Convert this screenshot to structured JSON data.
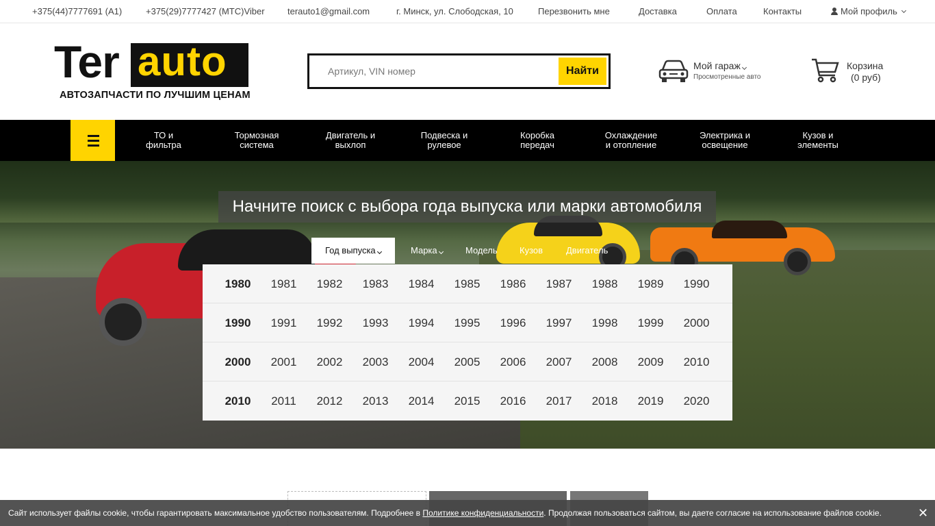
{
  "topbar": {
    "phone_a1": "+375(44)7777691 (A1)",
    "phone_mts": "+375(29)7777427 (МТС)Viber",
    "email": "terauto1@gmail.com",
    "address": "г. Минск, ул. Слободская, 10",
    "callback": "Перезвонить мне",
    "delivery": "Доставка",
    "payment": "Оплата",
    "contacts": "Контакты",
    "profile": "Мой профиль"
  },
  "logo": {
    "part1": "Ter",
    "part2": "auto",
    "tagline": "АВТОЗАПЧАСТИ ПО ЛУЧШИМ ЦЕНАМ"
  },
  "search": {
    "placeholder": "Артикул, VIN номер",
    "button": "Найти"
  },
  "garage": {
    "title": "Мой гараж",
    "subtitle": "Просмотренные авто"
  },
  "cart": {
    "title": "Корзина",
    "sum": "(0 руб)"
  },
  "nav": {
    "categories": [
      "ТО и\nфильтра",
      "Тормозная\nсистема",
      "Двигатель и\nвыхлоп",
      "Подвеска и\nрулевое",
      "Коробка\nпередач",
      "Охлаждение\nи отопление",
      "Электрика и\nосвещение",
      "Кузов и\nэлементы"
    ]
  },
  "hero": {
    "title": "Начните поиск с выбора года выпуска или марки автомобиля",
    "tabs": [
      "Год выпуска",
      "Марка",
      "Модель",
      "Кузов",
      "Двигатель"
    ],
    "year_rows": [
      [
        "1980",
        "1981",
        "1982",
        "1983",
        "1984",
        "1985",
        "1986",
        "1987",
        "1988",
        "1989",
        "1990"
      ],
      [
        "1990",
        "1991",
        "1992",
        "1993",
        "1994",
        "1995",
        "1996",
        "1997",
        "1998",
        "1999",
        "2000"
      ],
      [
        "2000",
        "2001",
        "2002",
        "2003",
        "2004",
        "2005",
        "2006",
        "2007",
        "2008",
        "2009",
        "2010"
      ],
      [
        "2010",
        "2011",
        "2012",
        "2013",
        "2014",
        "2015",
        "2016",
        "2017",
        "2018",
        "2019",
        "2020"
      ]
    ]
  },
  "cookie": {
    "text_before": "Сайт использует файлы cookie, чтобы гарантировать максимальное удобство пользователям. Подробнее в ",
    "link": "Политике конфиденциальности",
    "text_after": ". Продолжая пользоваться сайтом, вы даете согласие на использование файлов cookie.",
    "close": "✕"
  },
  "colors": {
    "accent": "#ffd400",
    "dark": "#000000"
  }
}
